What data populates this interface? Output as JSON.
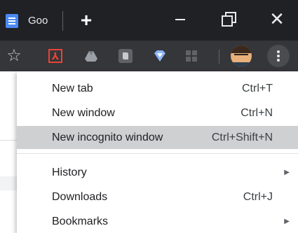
{
  "window": {
    "tab_title": "Goo",
    "new_tab_symbol": "+",
    "close_symbol": "✕"
  },
  "toolbar": {
    "bookmark_star_symbol": "☆",
    "acrobat_symbol": "⅄"
  },
  "menu": {
    "items": [
      {
        "label": "New tab",
        "shortcut": "Ctrl+T"
      },
      {
        "label": "New window",
        "shortcut": "Ctrl+N"
      },
      {
        "label": "New incognito window",
        "shortcut": "Ctrl+Shift+N",
        "highlighted": true
      },
      {
        "label": "History",
        "submenu_symbol": "▶"
      },
      {
        "label": "Downloads",
        "shortcut": "Ctrl+J"
      },
      {
        "label": "Bookmarks",
        "submenu_symbol": "▶"
      }
    ]
  },
  "colors": {
    "titlebar": "#202124",
    "toolbar": "#35363a",
    "menu_background": "#ffffff",
    "menu_highlight": "#cfd0d2",
    "favicon_blue": "#4a8af4",
    "acrobat_red": "#ea4335"
  },
  "icons": [
    "docs-favicon-icon",
    "plus-icon",
    "minimize-icon",
    "restore-icon",
    "close-icon",
    "star-icon",
    "acrobat-extension-icon",
    "drive-extension-icon",
    "evernote-extension-icon",
    "vpn-extension-icon",
    "grid-extension-icon",
    "profile-avatar",
    "more-vert-icon",
    "chevron-right-icon"
  ]
}
